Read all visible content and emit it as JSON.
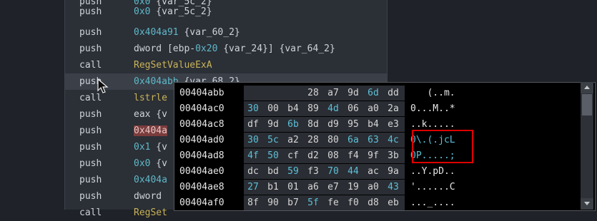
{
  "disassembly": [
    {
      "mnemonic": "push",
      "operand": "0x0 {var_5c_2}"
    },
    {
      "mnemonic": "push",
      "operand": "0x404a91 {var_60_2}"
    },
    {
      "mnemonic": "push",
      "operand": "dword [ebp-0x20 {var_24}] {var_64_2}"
    },
    {
      "mnemonic": "call",
      "operand": "RegSetValueExA"
    },
    {
      "mnemonic": "push",
      "operand": "0x404abb {var_68_2}"
    },
    {
      "mnemonic": "call",
      "operand": "lstrle"
    },
    {
      "mnemonic": "push",
      "operand": "eax {v"
    },
    {
      "mnemonic": "push",
      "operand": "0x404a"
    },
    {
      "mnemonic": "push",
      "operand": "0x1 {v"
    },
    {
      "mnemonic": "push",
      "operand": "0x0 {v"
    },
    {
      "mnemonic": "push",
      "operand": "0x404a"
    },
    {
      "mnemonic": "push",
      "operand": "dword"
    },
    {
      "mnemonic": "call",
      "operand": "RegSet"
    }
  ],
  "popup": {
    "rows": [
      {
        "address": "00404abb",
        "bytes": [
          "",
          "",
          "",
          "28",
          "a7",
          "9d",
          "6d",
          "dd"
        ],
        "ascii": "   (..m."
      },
      {
        "address": "00404ac0",
        "bytes": [
          "30",
          "00",
          "b4",
          "89",
          "4d",
          "06",
          "a0",
          "2a"
        ],
        "ascii": "0...M..*"
      },
      {
        "address": "00404ac8",
        "bytes": [
          "df",
          "9d",
          "6b",
          "8d",
          "d9",
          "95",
          "b4",
          "e3"
        ],
        "ascii": "..k....."
      },
      {
        "address": "00404ad0",
        "bytes": [
          "30",
          "5c",
          "a2",
          "28",
          "80",
          "6a",
          "63",
          "4c"
        ],
        "ascii": "0\\.(.jcL"
      },
      {
        "address": "00404ad8",
        "bytes": [
          "4f",
          "50",
          "cf",
          "d2",
          "08",
          "f4",
          "9f",
          "3b"
        ],
        "ascii": "OP.....;"
      },
      {
        "address": "00404ae0",
        "bytes": [
          "dc",
          "bd",
          "59",
          "f3",
          "70",
          "44",
          "ac",
          "9a"
        ],
        "ascii": "..Y.pD.."
      },
      {
        "address": "00404ae8",
        "bytes": [
          "27",
          "b1",
          "01",
          "a6",
          "e7",
          "19",
          "a0",
          "43"
        ],
        "ascii": "'......C"
      },
      {
        "address": "00404af0",
        "bytes": [
          "8f",
          "90",
          "b7",
          "5f",
          "fe",
          "f0",
          "d8",
          "eb"
        ],
        "ascii": "..._...."
      }
    ]
  },
  "colors": {
    "number": "#5fb8c8",
    "function": "#c9b45a",
    "highlight_marker": "#e00000"
  }
}
